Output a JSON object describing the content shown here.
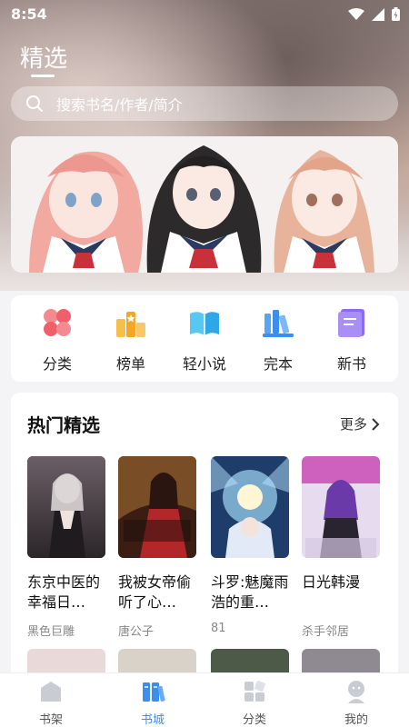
{
  "status": {
    "time": "8:54"
  },
  "header": {
    "title": "精选"
  },
  "search": {
    "placeholder": "搜索书名/作者/简介"
  },
  "categories": [
    {
      "label": "分类",
      "icon": "four-petal-icon",
      "color": "#f0606a"
    },
    {
      "label": "榜单",
      "icon": "ranking-icon",
      "color": "#f5a623"
    },
    {
      "label": "轻小说",
      "icon": "open-book-icon",
      "color": "#41b6ee"
    },
    {
      "label": "完本",
      "icon": "bookshelf-icon",
      "color": "#3a8ef0"
    },
    {
      "label": "新书",
      "icon": "new-book-icon",
      "color": "#8a6cf0"
    }
  ],
  "hot": {
    "title": "热门精选",
    "more": "更多",
    "books": [
      {
        "title": "东京中医的幸福日…",
        "author": "黑色巨雕"
      },
      {
        "title": "我被女帝偷听了心…",
        "author": "唐公子"
      },
      {
        "title": "斗罗:魅魔雨浩的重…",
        "author": "81"
      },
      {
        "title": "日光韩漫",
        "author": "杀手邻居"
      }
    ]
  },
  "tabbar": [
    {
      "label": "书架",
      "icon": "shelf-icon",
      "active": false
    },
    {
      "label": "书城",
      "icon": "bookstore-icon",
      "active": true
    },
    {
      "label": "分类",
      "icon": "category-grid-icon",
      "active": false
    },
    {
      "label": "我的",
      "icon": "profile-icon",
      "active": false
    }
  ],
  "colors": {
    "accent": "#3a8ef0"
  }
}
